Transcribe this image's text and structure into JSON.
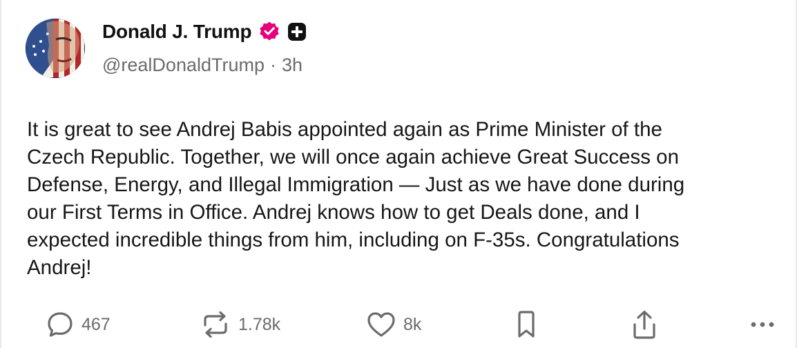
{
  "post": {
    "author": {
      "display_name": "Donald J. Trump",
      "handle": "@realDonaldTrump",
      "separator": "·",
      "time": "3h",
      "verified_icon": "verified-badge-icon",
      "badge_icon": "plus-badge-icon"
    },
    "text": "It is great to see Andrej Babis appointed again as Prime Minister of the\nCzech Republic. Together, we will once again achieve Great Success on\nDefense, Energy, and Illegal Immigration — Just as we have done during\nour First Terms in Office. Andrej knows how to get Deals done, and I\nexpected incredible things from him, including on F-35s. Congratulations\nAndrej!",
    "actions": {
      "reply": {
        "icon": "comment-icon",
        "count": "467"
      },
      "retruth": {
        "icon": "repost-icon",
        "count": "1.78k"
      },
      "like": {
        "icon": "heart-icon",
        "count": "8k"
      },
      "bookmark": {
        "icon": "bookmark-icon"
      },
      "share": {
        "icon": "share-icon"
      },
      "more": {
        "icon": "more-icon"
      }
    }
  },
  "colors": {
    "verified": "#e5007a",
    "text": "#161616",
    "muted": "#6b6b6b",
    "name": "#111111"
  }
}
